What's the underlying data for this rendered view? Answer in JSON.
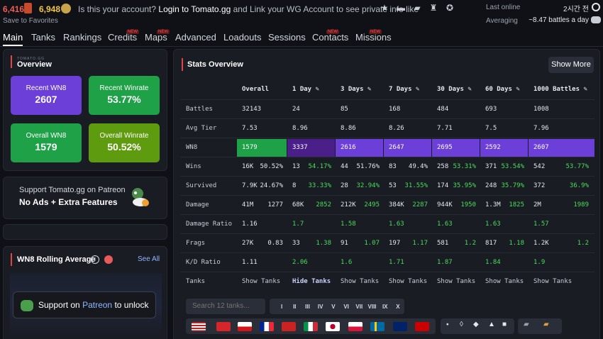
{
  "topbar": {
    "gold_count": "6,416",
    "credits_count": "6,948",
    "save_favorites": "Save to Favorites",
    "msg_prefix": "Is this your account?",
    "msg_link": "Login to Tomato.gg",
    "msg_suffix": "and Link your WG Account to see private info like",
    "last_online_label": "Last online",
    "last_online_value": "2시간 전",
    "averaging_label": "Averaging",
    "averaging_value": "~8.47 battles a day"
  },
  "nav": {
    "items": [
      {
        "label": "Main",
        "active": true
      },
      {
        "label": "Tanks"
      },
      {
        "label": "Rankings"
      },
      {
        "label": "Credits",
        "tag": "NEW"
      },
      {
        "label": "Maps",
        "tag": "NEW"
      },
      {
        "label": "Advanced"
      },
      {
        "label": "Loadouts"
      },
      {
        "label": "Sessions"
      },
      {
        "label": "Contacts",
        "tag": "NEW"
      },
      {
        "label": "Missions",
        "tag": "NEW"
      }
    ]
  },
  "overview": {
    "tiny_label": "TOMATO.GG",
    "title": "Overview",
    "tiles": [
      {
        "label": "Recent WN8",
        "value": "2607",
        "color": "#6c3fd9"
      },
      {
        "label": "Recent Winrate",
        "value": "53.77%",
        "color": "#1fa148"
      },
      {
        "label": "Overall WN8",
        "value": "1579",
        "color": "#1fa148"
      },
      {
        "label": "Overall Winrate",
        "value": "50.52%",
        "color": "#5f9b0e"
      }
    ]
  },
  "patreon": {
    "line1": "Support Tomato.gg on Patreon",
    "line2": "No Ads + Extra Features"
  },
  "rolling": {
    "title": "WN8 Rolling Average",
    "see_all": "See All",
    "unlock_prefix": "Support on",
    "unlock_link": "Patreon",
    "unlock_suffix": "to unlock"
  },
  "stats": {
    "title": "Stats Overview",
    "show_more": "Show More",
    "columns": [
      "Overall",
      "1 Day",
      "3 Days",
      "7 Days",
      "30 Days",
      "60 Days",
      "1000 Battles"
    ],
    "rows": {
      "battles": {
        "label": "Battles",
        "values": [
          "32143",
          "24",
          "85",
          "168",
          "484",
          "693",
          "1008"
        ]
      },
      "avg_tier": {
        "label": "Avg Tier",
        "values": [
          "7.53",
          "8.96",
          "8.86",
          "8.26",
          "7.71",
          "7.5",
          "7.96"
        ]
      },
      "wn8": {
        "label": "WN8",
        "values": [
          "1579",
          "3337",
          "2616",
          "2647",
          "2695",
          "2592",
          "2607"
        ],
        "colors": [
          "#1fa148",
          "#4a1f8a",
          "#6c3fd9",
          "#6c3fd9",
          "#6c3fd9",
          "#6c3fd9",
          "#6c3fd9"
        ]
      },
      "wins": {
        "label": "Wins",
        "a": [
          "16K",
          "13",
          "44",
          "83",
          "258",
          "371",
          "542"
        ],
        "b": [
          "50.52%",
          "54.17%",
          "51.76%",
          "49.4%",
          "53.31%",
          "53.54%",
          "53.77%"
        ]
      },
      "survived": {
        "label": "Survived",
        "a": [
          "7.9K",
          "8",
          "28",
          "53",
          "174",
          "248",
          "372"
        ],
        "b": [
          "24.67%",
          "33.33%",
          "32.94%",
          "31.55%",
          "35.95%",
          "35.79%",
          "36.9%"
        ]
      },
      "damage": {
        "label": "Damage",
        "a": [
          "41M",
          "68K",
          "212K",
          "384K",
          "944K",
          "1.3M",
          "2M"
        ],
        "b": [
          "1277",
          "2852",
          "2495",
          "2287",
          "1950",
          "1825",
          "1989"
        ]
      },
      "damage_ratio": {
        "label": "Damage Ratio",
        "values": [
          "1.16",
          "1.7",
          "1.58",
          "1.63",
          "1.63",
          "1.63",
          "1.57"
        ]
      },
      "frags": {
        "label": "Frags",
        "a": [
          "27K",
          "33",
          "91",
          "197",
          "581",
          "817",
          "1.2K"
        ],
        "b": [
          "0.83",
          "1.38",
          "1.07",
          "1.17",
          "1.2",
          "1.18",
          "1.2"
        ]
      },
      "kd": {
        "label": "K/D Ratio",
        "values": [
          "1.11",
          "2.06",
          "1.6",
          "1.71",
          "1.87",
          "1.84",
          "1.9"
        ]
      },
      "tanks": {
        "label": "Tanks",
        "values": [
          "Show Tanks",
          "Hide Tanks",
          "Show Tanks",
          "Show Tanks",
          "Show Tanks",
          "Show Tanks",
          "Show Tanks"
        ]
      }
    },
    "search_placeholder": "Search 12 tanks...",
    "tiers": [
      "I",
      "II",
      "III",
      "IV",
      "V",
      "VI",
      "VII",
      "VIII",
      "IX",
      "X"
    ]
  }
}
